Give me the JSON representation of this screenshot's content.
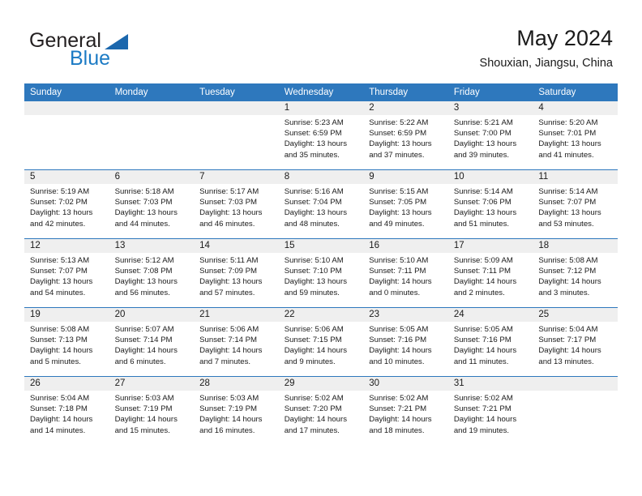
{
  "brand": {
    "name_part1": "General",
    "name_part2": "Blue",
    "logo_icon": "triangle-logo-icon"
  },
  "header": {
    "month_title": "May 2024",
    "location": "Shouxian, Jiangsu, China"
  },
  "calendar": {
    "weekday_headers": [
      "Sunday",
      "Monday",
      "Tuesday",
      "Wednesday",
      "Thursday",
      "Friday",
      "Saturday"
    ],
    "header_bg_color": "#2e78bd",
    "daynum_band_color": "#efefef",
    "row_separator_color": "#2e78bd",
    "weeks": [
      [
        {
          "day": "",
          "lines": []
        },
        {
          "day": "",
          "lines": []
        },
        {
          "day": "",
          "lines": []
        },
        {
          "day": "1",
          "lines": [
            "Sunrise: 5:23 AM",
            "Sunset: 6:59 PM",
            "Daylight: 13 hours",
            "and 35 minutes."
          ]
        },
        {
          "day": "2",
          "lines": [
            "Sunrise: 5:22 AM",
            "Sunset: 6:59 PM",
            "Daylight: 13 hours",
            "and 37 minutes."
          ]
        },
        {
          "day": "3",
          "lines": [
            "Sunrise: 5:21 AM",
            "Sunset: 7:00 PM",
            "Daylight: 13 hours",
            "and 39 minutes."
          ]
        },
        {
          "day": "4",
          "lines": [
            "Sunrise: 5:20 AM",
            "Sunset: 7:01 PM",
            "Daylight: 13 hours",
            "and 41 minutes."
          ]
        }
      ],
      [
        {
          "day": "5",
          "lines": [
            "Sunrise: 5:19 AM",
            "Sunset: 7:02 PM",
            "Daylight: 13 hours",
            "and 42 minutes."
          ]
        },
        {
          "day": "6",
          "lines": [
            "Sunrise: 5:18 AM",
            "Sunset: 7:03 PM",
            "Daylight: 13 hours",
            "and 44 minutes."
          ]
        },
        {
          "day": "7",
          "lines": [
            "Sunrise: 5:17 AM",
            "Sunset: 7:03 PM",
            "Daylight: 13 hours",
            "and 46 minutes."
          ]
        },
        {
          "day": "8",
          "lines": [
            "Sunrise: 5:16 AM",
            "Sunset: 7:04 PM",
            "Daylight: 13 hours",
            "and 48 minutes."
          ]
        },
        {
          "day": "9",
          "lines": [
            "Sunrise: 5:15 AM",
            "Sunset: 7:05 PM",
            "Daylight: 13 hours",
            "and 49 minutes."
          ]
        },
        {
          "day": "10",
          "lines": [
            "Sunrise: 5:14 AM",
            "Sunset: 7:06 PM",
            "Daylight: 13 hours",
            "and 51 minutes."
          ]
        },
        {
          "day": "11",
          "lines": [
            "Sunrise: 5:14 AM",
            "Sunset: 7:07 PM",
            "Daylight: 13 hours",
            "and 53 minutes."
          ]
        }
      ],
      [
        {
          "day": "12",
          "lines": [
            "Sunrise: 5:13 AM",
            "Sunset: 7:07 PM",
            "Daylight: 13 hours",
            "and 54 minutes."
          ]
        },
        {
          "day": "13",
          "lines": [
            "Sunrise: 5:12 AM",
            "Sunset: 7:08 PM",
            "Daylight: 13 hours",
            "and 56 minutes."
          ]
        },
        {
          "day": "14",
          "lines": [
            "Sunrise: 5:11 AM",
            "Sunset: 7:09 PM",
            "Daylight: 13 hours",
            "and 57 minutes."
          ]
        },
        {
          "day": "15",
          "lines": [
            "Sunrise: 5:10 AM",
            "Sunset: 7:10 PM",
            "Daylight: 13 hours",
            "and 59 minutes."
          ]
        },
        {
          "day": "16",
          "lines": [
            "Sunrise: 5:10 AM",
            "Sunset: 7:11 PM",
            "Daylight: 14 hours",
            "and 0 minutes."
          ]
        },
        {
          "day": "17",
          "lines": [
            "Sunrise: 5:09 AM",
            "Sunset: 7:11 PM",
            "Daylight: 14 hours",
            "and 2 minutes."
          ]
        },
        {
          "day": "18",
          "lines": [
            "Sunrise: 5:08 AM",
            "Sunset: 7:12 PM",
            "Daylight: 14 hours",
            "and 3 minutes."
          ]
        }
      ],
      [
        {
          "day": "19",
          "lines": [
            "Sunrise: 5:08 AM",
            "Sunset: 7:13 PM",
            "Daylight: 14 hours",
            "and 5 minutes."
          ]
        },
        {
          "day": "20",
          "lines": [
            "Sunrise: 5:07 AM",
            "Sunset: 7:14 PM",
            "Daylight: 14 hours",
            "and 6 minutes."
          ]
        },
        {
          "day": "21",
          "lines": [
            "Sunrise: 5:06 AM",
            "Sunset: 7:14 PM",
            "Daylight: 14 hours",
            "and 7 minutes."
          ]
        },
        {
          "day": "22",
          "lines": [
            "Sunrise: 5:06 AM",
            "Sunset: 7:15 PM",
            "Daylight: 14 hours",
            "and 9 minutes."
          ]
        },
        {
          "day": "23",
          "lines": [
            "Sunrise: 5:05 AM",
            "Sunset: 7:16 PM",
            "Daylight: 14 hours",
            "and 10 minutes."
          ]
        },
        {
          "day": "24",
          "lines": [
            "Sunrise: 5:05 AM",
            "Sunset: 7:16 PM",
            "Daylight: 14 hours",
            "and 11 minutes."
          ]
        },
        {
          "day": "25",
          "lines": [
            "Sunrise: 5:04 AM",
            "Sunset: 7:17 PM",
            "Daylight: 14 hours",
            "and 13 minutes."
          ]
        }
      ],
      [
        {
          "day": "26",
          "lines": [
            "Sunrise: 5:04 AM",
            "Sunset: 7:18 PM",
            "Daylight: 14 hours",
            "and 14 minutes."
          ]
        },
        {
          "day": "27",
          "lines": [
            "Sunrise: 5:03 AM",
            "Sunset: 7:19 PM",
            "Daylight: 14 hours",
            "and 15 minutes."
          ]
        },
        {
          "day": "28",
          "lines": [
            "Sunrise: 5:03 AM",
            "Sunset: 7:19 PM",
            "Daylight: 14 hours",
            "and 16 minutes."
          ]
        },
        {
          "day": "29",
          "lines": [
            "Sunrise: 5:02 AM",
            "Sunset: 7:20 PM",
            "Daylight: 14 hours",
            "and 17 minutes."
          ]
        },
        {
          "day": "30",
          "lines": [
            "Sunrise: 5:02 AM",
            "Sunset: 7:21 PM",
            "Daylight: 14 hours",
            "and 18 minutes."
          ]
        },
        {
          "day": "31",
          "lines": [
            "Sunrise: 5:02 AM",
            "Sunset: 7:21 PM",
            "Daylight: 14 hours",
            "and 19 minutes."
          ]
        },
        {
          "day": "",
          "lines": []
        }
      ]
    ]
  }
}
